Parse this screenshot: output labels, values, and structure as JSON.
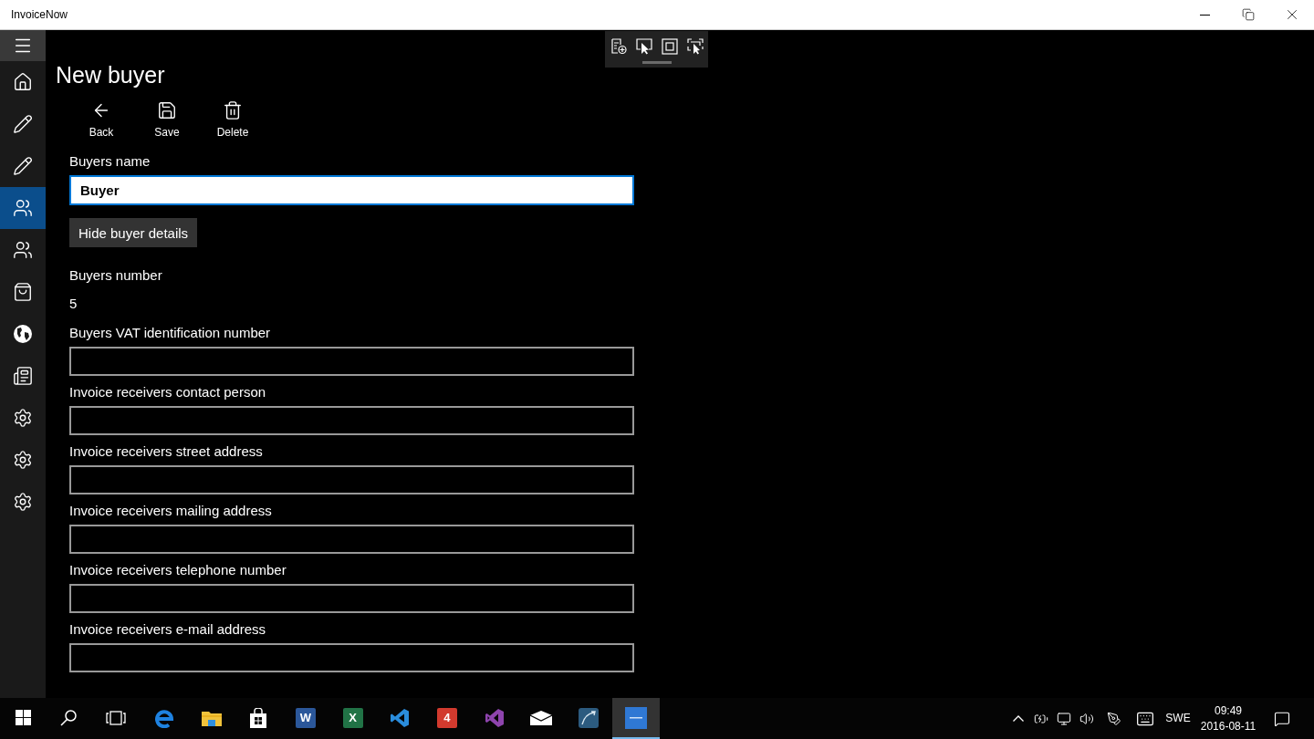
{
  "window": {
    "title": "InvoiceNow"
  },
  "sidebar": {
    "items": [
      {
        "kind": "home",
        "selected": false
      },
      {
        "kind": "edit",
        "selected": false
      },
      {
        "kind": "edit",
        "selected": false
      },
      {
        "kind": "people",
        "selected": true
      },
      {
        "kind": "people",
        "selected": false
      },
      {
        "kind": "bag",
        "selected": false
      },
      {
        "kind": "globe",
        "selected": false
      },
      {
        "kind": "news",
        "selected": false
      },
      {
        "kind": "settings",
        "selected": false
      },
      {
        "kind": "settings",
        "selected": false
      },
      {
        "kind": "settings",
        "selected": false
      }
    ]
  },
  "page": {
    "title": "New buyer",
    "commands": [
      {
        "kind": "back",
        "label": "Back"
      },
      {
        "kind": "save",
        "label": "Save"
      },
      {
        "kind": "delete",
        "label": "Delete"
      }
    ],
    "buyer_name": {
      "label": "Buyers name",
      "value": "Buyer",
      "focused": true
    },
    "details_button": "Hide buyer details",
    "buyer_number": {
      "label": "Buyers number",
      "value": "5"
    },
    "fields": [
      {
        "label": "Buyers VAT identification number"
      },
      {
        "label": "Invoice receivers contact person"
      },
      {
        "label": "Invoice receivers street address"
      },
      {
        "label": "Invoice receivers mailing address"
      },
      {
        "label": "Invoice receivers telephone number"
      },
      {
        "label": "Invoice receivers e-mail address"
      }
    ]
  },
  "taskbar": {
    "buttons": [
      {
        "kind": "start",
        "selected": false
      },
      {
        "kind": "search",
        "selected": false
      },
      {
        "kind": "taskview",
        "selected": false
      },
      {
        "kind": "browser",
        "selected": false
      },
      {
        "kind": "folder",
        "selected": false
      },
      {
        "kind": "store",
        "selected": false
      },
      {
        "kind": "tile",
        "letter": "W",
        "color": "#2b579a",
        "selected": false
      },
      {
        "kind": "tile",
        "letter": "X",
        "color": "#217346",
        "selected": false
      },
      {
        "kind": "editor",
        "selected": false
      },
      {
        "kind": "tile",
        "letter": "4",
        "color": "#d23a2e",
        "selected": false
      },
      {
        "kind": "ide",
        "selected": false
      },
      {
        "kind": "mail",
        "selected": false
      },
      {
        "kind": "database",
        "selected": false
      },
      {
        "kind": "app",
        "selected": true
      }
    ],
    "tray": {
      "language": "SWE",
      "time": "09:49",
      "date": "2016-08-11"
    }
  }
}
